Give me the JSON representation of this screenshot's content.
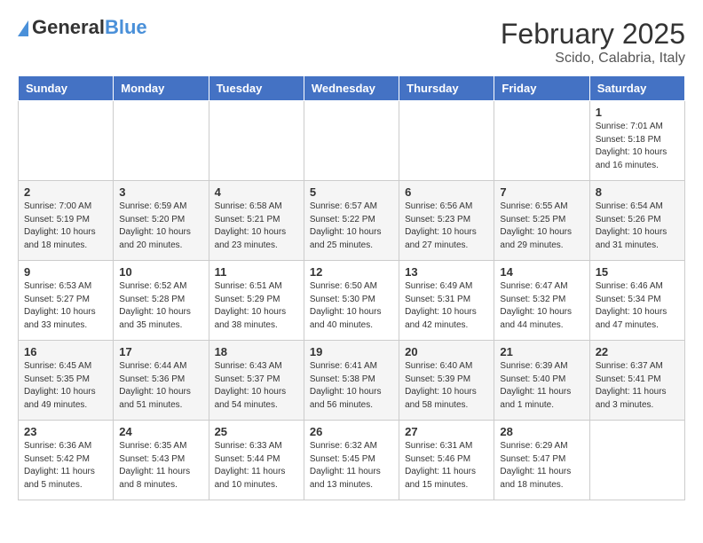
{
  "header": {
    "logo_general": "General",
    "logo_blue": "Blue",
    "title": "February 2025",
    "location": "Scido, Calabria, Italy"
  },
  "weekdays": [
    "Sunday",
    "Monday",
    "Tuesday",
    "Wednesday",
    "Thursday",
    "Friday",
    "Saturday"
  ],
  "weeks": [
    [
      {
        "day": "",
        "info": ""
      },
      {
        "day": "",
        "info": ""
      },
      {
        "day": "",
        "info": ""
      },
      {
        "day": "",
        "info": ""
      },
      {
        "day": "",
        "info": ""
      },
      {
        "day": "",
        "info": ""
      },
      {
        "day": "1",
        "info": "Sunrise: 7:01 AM\nSunset: 5:18 PM\nDaylight: 10 hours\nand 16 minutes."
      }
    ],
    [
      {
        "day": "2",
        "info": "Sunrise: 7:00 AM\nSunset: 5:19 PM\nDaylight: 10 hours\nand 18 minutes."
      },
      {
        "day": "3",
        "info": "Sunrise: 6:59 AM\nSunset: 5:20 PM\nDaylight: 10 hours\nand 20 minutes."
      },
      {
        "day": "4",
        "info": "Sunrise: 6:58 AM\nSunset: 5:21 PM\nDaylight: 10 hours\nand 23 minutes."
      },
      {
        "day": "5",
        "info": "Sunrise: 6:57 AM\nSunset: 5:22 PM\nDaylight: 10 hours\nand 25 minutes."
      },
      {
        "day": "6",
        "info": "Sunrise: 6:56 AM\nSunset: 5:23 PM\nDaylight: 10 hours\nand 27 minutes."
      },
      {
        "day": "7",
        "info": "Sunrise: 6:55 AM\nSunset: 5:25 PM\nDaylight: 10 hours\nand 29 minutes."
      },
      {
        "day": "8",
        "info": "Sunrise: 6:54 AM\nSunset: 5:26 PM\nDaylight: 10 hours\nand 31 minutes."
      }
    ],
    [
      {
        "day": "9",
        "info": "Sunrise: 6:53 AM\nSunset: 5:27 PM\nDaylight: 10 hours\nand 33 minutes."
      },
      {
        "day": "10",
        "info": "Sunrise: 6:52 AM\nSunset: 5:28 PM\nDaylight: 10 hours\nand 35 minutes."
      },
      {
        "day": "11",
        "info": "Sunrise: 6:51 AM\nSunset: 5:29 PM\nDaylight: 10 hours\nand 38 minutes."
      },
      {
        "day": "12",
        "info": "Sunrise: 6:50 AM\nSunset: 5:30 PM\nDaylight: 10 hours\nand 40 minutes."
      },
      {
        "day": "13",
        "info": "Sunrise: 6:49 AM\nSunset: 5:31 PM\nDaylight: 10 hours\nand 42 minutes."
      },
      {
        "day": "14",
        "info": "Sunrise: 6:47 AM\nSunset: 5:32 PM\nDaylight: 10 hours\nand 44 minutes."
      },
      {
        "day": "15",
        "info": "Sunrise: 6:46 AM\nSunset: 5:34 PM\nDaylight: 10 hours\nand 47 minutes."
      }
    ],
    [
      {
        "day": "16",
        "info": "Sunrise: 6:45 AM\nSunset: 5:35 PM\nDaylight: 10 hours\nand 49 minutes."
      },
      {
        "day": "17",
        "info": "Sunrise: 6:44 AM\nSunset: 5:36 PM\nDaylight: 10 hours\nand 51 minutes."
      },
      {
        "day": "18",
        "info": "Sunrise: 6:43 AM\nSunset: 5:37 PM\nDaylight: 10 hours\nand 54 minutes."
      },
      {
        "day": "19",
        "info": "Sunrise: 6:41 AM\nSunset: 5:38 PM\nDaylight: 10 hours\nand 56 minutes."
      },
      {
        "day": "20",
        "info": "Sunrise: 6:40 AM\nSunset: 5:39 PM\nDaylight: 10 hours\nand 58 minutes."
      },
      {
        "day": "21",
        "info": "Sunrise: 6:39 AM\nSunset: 5:40 PM\nDaylight: 11 hours\nand 1 minute."
      },
      {
        "day": "22",
        "info": "Sunrise: 6:37 AM\nSunset: 5:41 PM\nDaylight: 11 hours\nand 3 minutes."
      }
    ],
    [
      {
        "day": "23",
        "info": "Sunrise: 6:36 AM\nSunset: 5:42 PM\nDaylight: 11 hours\nand 5 minutes."
      },
      {
        "day": "24",
        "info": "Sunrise: 6:35 AM\nSunset: 5:43 PM\nDaylight: 11 hours\nand 8 minutes."
      },
      {
        "day": "25",
        "info": "Sunrise: 6:33 AM\nSunset: 5:44 PM\nDaylight: 11 hours\nand 10 minutes."
      },
      {
        "day": "26",
        "info": "Sunrise: 6:32 AM\nSunset: 5:45 PM\nDaylight: 11 hours\nand 13 minutes."
      },
      {
        "day": "27",
        "info": "Sunrise: 6:31 AM\nSunset: 5:46 PM\nDaylight: 11 hours\nand 15 minutes."
      },
      {
        "day": "28",
        "info": "Sunrise: 6:29 AM\nSunset: 5:47 PM\nDaylight: 11 hours\nand 18 minutes."
      },
      {
        "day": "",
        "info": ""
      }
    ]
  ]
}
